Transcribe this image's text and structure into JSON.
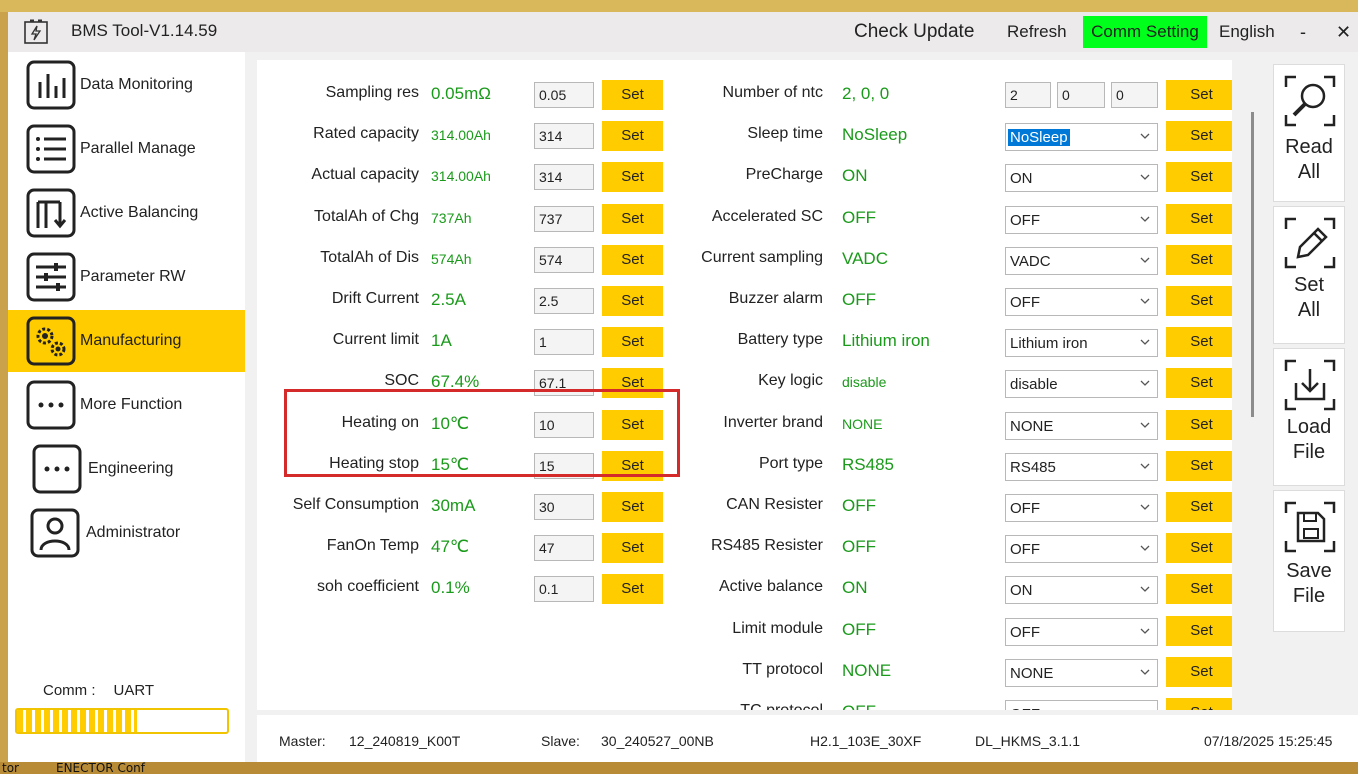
{
  "window": {
    "title": "BMS Tool-V1.14.59",
    "toolbar": {
      "check_update": "Check Update",
      "refresh": "Refresh",
      "comm_setting": "Comm Setting",
      "language": "English",
      "minimize": "-",
      "close": "✕"
    }
  },
  "sidebar": {
    "items": [
      {
        "label": "Data Monitoring",
        "icon": "bar-chart-icon"
      },
      {
        "label": "Parallel Manage",
        "icon": "list-icon"
      },
      {
        "label": "Active Balancing",
        "icon": "balance-icon"
      },
      {
        "label": "Parameter RW",
        "icon": "sliders-icon"
      },
      {
        "label": "Manufacturing",
        "icon": "gears-icon",
        "active": true
      },
      {
        "label": "More Function",
        "icon": "more-icon"
      },
      {
        "label": "Engineering",
        "icon": "more-icon"
      },
      {
        "label": "Administrator",
        "icon": "user-icon"
      }
    ],
    "comm_label": "Comm :",
    "comm_value": "UART",
    "progress": 0.57
  },
  "params_left": [
    {
      "label": "Sampling res",
      "value": "0.05mΩ",
      "input": "0.05",
      "set": "Set"
    },
    {
      "label": "Rated capacity",
      "value": "314.00Ah",
      "input": "314",
      "set": "Set",
      "small": true
    },
    {
      "label": "Actual capacity",
      "value": "314.00Ah",
      "input": "314",
      "set": "Set",
      "small": true
    },
    {
      "label": "TotalAh of Chg",
      "value": "737Ah",
      "input": "737",
      "set": "Set",
      "small": true
    },
    {
      "label": "TotalAh of Dis",
      "value": "574Ah",
      "input": "574",
      "set": "Set",
      "small": true
    },
    {
      "label": "Drift Current",
      "value": "2.5A",
      "input": "2.5",
      "set": "Set"
    },
    {
      "label": "Current limit",
      "value": "1A",
      "input": "1",
      "set": "Set"
    },
    {
      "label": "SOC",
      "value": "67.4%",
      "input": "67.1",
      "set": "Set"
    },
    {
      "label": "Heating on",
      "value": "10℃",
      "input": "10",
      "set": "Set"
    },
    {
      "label": "Heating stop",
      "value": "15℃",
      "input": "15",
      "set": "Set"
    },
    {
      "label": "Self Consumption",
      "value": "30mA",
      "input": "30",
      "set": "Set"
    },
    {
      "label": "FanOn Temp",
      "value": "47℃",
      "input": "47",
      "set": "Set"
    },
    {
      "label": "soh coefficient",
      "value": "0.1%",
      "input": "0.1",
      "set": "Set"
    }
  ],
  "ntc_row": {
    "label": "Number of ntc",
    "value": "2, 0, 0",
    "inputs": [
      "2",
      "0",
      "0"
    ],
    "set": "Set"
  },
  "params_right": [
    {
      "label": "Sleep time",
      "value": "NoSleep",
      "selected": "NoSleep",
      "set": "Set",
      "highlight": true
    },
    {
      "label": "PreCharge",
      "value": "ON",
      "selected": "ON",
      "set": "Set"
    },
    {
      "label": "Accelerated SC",
      "value": "OFF",
      "selected": "OFF",
      "set": "Set"
    },
    {
      "label": "Current sampling",
      "value": "VADC",
      "selected": "VADC",
      "set": "Set"
    },
    {
      "label": "Buzzer alarm",
      "value": "OFF",
      "selected": "OFF",
      "set": "Set"
    },
    {
      "label": "Battery type",
      "value": "Lithium iron",
      "selected": "Lithium iron",
      "set": "Set"
    },
    {
      "label": "Key logic",
      "value": "disable",
      "selected": "disable",
      "set": "Set",
      "small": true
    },
    {
      "label": "Inverter brand",
      "value": "NONE",
      "selected": "NONE",
      "set": "Set",
      "small": true
    },
    {
      "label": "Port type",
      "value": "RS485",
      "selected": "RS485",
      "set": "Set"
    },
    {
      "label": "CAN Resister",
      "value": "OFF",
      "selected": "OFF",
      "set": "Set"
    },
    {
      "label": "RS485 Resister",
      "value": "OFF",
      "selected": "OFF",
      "set": "Set"
    },
    {
      "label": "Active balance",
      "value": "ON",
      "selected": "ON",
      "set": "Set"
    },
    {
      "label": "Limit module",
      "value": "OFF",
      "selected": "OFF",
      "set": "Set"
    },
    {
      "label": "TT protocol",
      "value": "NONE",
      "selected": "NONE",
      "set": "Set"
    },
    {
      "label": "TC protocol",
      "value": "OFF",
      "selected": "OFF",
      "set": "Set"
    }
  ],
  "actions": [
    {
      "label1": "Read",
      "label2": "All",
      "icon": "search-icon"
    },
    {
      "label1": "Set",
      "label2": "All",
      "icon": "pencil-icon"
    },
    {
      "label1": "Load",
      "label2": "File",
      "icon": "download-icon"
    },
    {
      "label1": "Save",
      "label2": "File",
      "icon": "save-icon"
    }
  ],
  "status": {
    "master_label": "Master:",
    "master_value": "12_240819_K00T",
    "slave_label": "Slave:",
    "slave_value": "30_240527_00NB",
    "hw": "H2.1_103E_30XF",
    "fw": "DL_HKMS_3.1.1",
    "datetime": "07/18/2025 15:25:45"
  },
  "desktop": {
    "bottom_left": "tor",
    "bottom_text": "ENECTOR Conf"
  }
}
